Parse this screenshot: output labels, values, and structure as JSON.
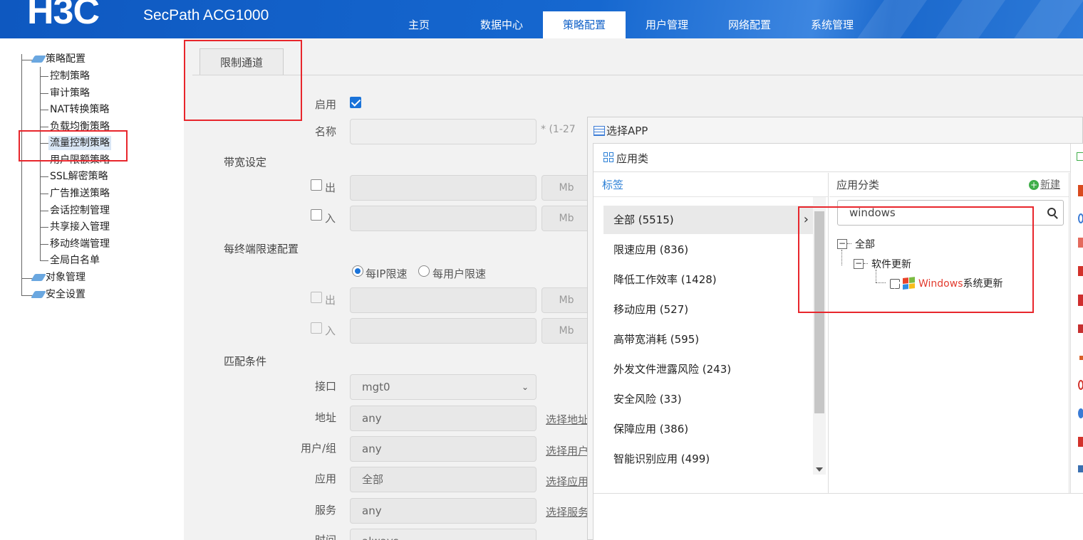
{
  "header": {
    "logo": "H3C",
    "product": "SecPath ACG1000",
    "nav": [
      "主页",
      "数据中心",
      "策略配置",
      "用户管理",
      "网络配置",
      "系统管理"
    ],
    "active_nav": "策略配置"
  },
  "sidebar": {
    "root": "策略配置",
    "items": [
      "控制策略",
      "审计策略",
      "NAT转换策略",
      "负载均衡策略",
      "流量控制策略",
      "用户限额策略",
      "SSL解密策略",
      "广告推送策略",
      "会话控制管理",
      "共享接入管理",
      "移动终端管理",
      "全局白名单"
    ],
    "extra": [
      "对象管理",
      "安全设置"
    ],
    "selected": "流量控制策略"
  },
  "form": {
    "tab": "限制通道",
    "enable_label": "启用",
    "name_label": "名称",
    "name_hint": "* (1-27",
    "bandwidth_section": "带宽设定",
    "out_label": "出",
    "in_label": "入",
    "unit": "Mb",
    "per_terminal_section": "每终端限速配置",
    "per_ip": "每IP限速",
    "per_user": "每用户限速",
    "match_section": "匹配条件",
    "interface_label": "接口",
    "interface_value": "mgt0",
    "address_label": "地址",
    "address_value": "any",
    "address_link": "选择地址",
    "user_label": "用户/组",
    "user_value": "any",
    "user_link": "选择用户",
    "app_label": "应用",
    "app_value": "全部",
    "app_link": "选择应用",
    "service_label": "服务",
    "service_value": "any",
    "service_link": "选择服务",
    "time_label": "时间",
    "time_value": "always"
  },
  "dialog": {
    "title": "选择APP",
    "group_title": "应用类",
    "tags_header": "标签",
    "categories": [
      "全部 (5515)",
      "限速应用 (836)",
      "降低工作效率 (1428)",
      "移动应用 (527)",
      "高带宽消耗 (595)",
      "外发文件泄露风险 (243)",
      "安全风险 (33)",
      "保障应用 (386)",
      "智能识别应用 (499)"
    ],
    "app_class_header": "应用分类",
    "new_link": "新建",
    "search_value": "windows",
    "tree": {
      "root": "全部",
      "child": "软件更新",
      "leaf_highlight": "Windows",
      "leaf_rest": "系统更新"
    }
  }
}
